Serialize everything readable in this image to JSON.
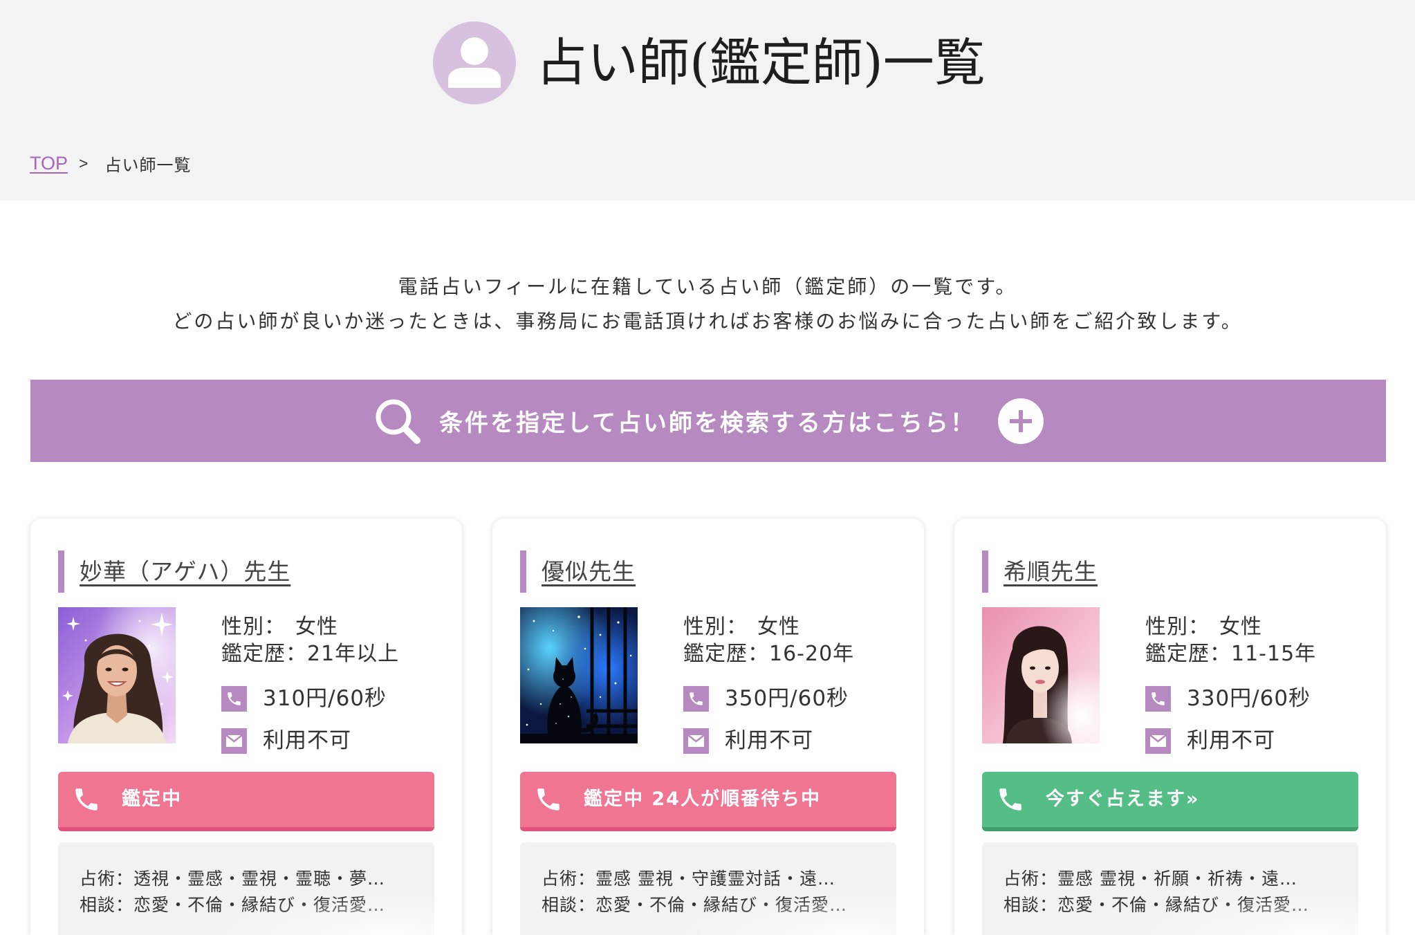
{
  "colors": {
    "accent": "#b68ac0",
    "avatar": "#d8c1df",
    "link": "#a865bb",
    "header": "#f3f3f3",
    "panel": "#f2f2f2"
  },
  "header": {
    "title": "占い師(鑑定師)一覧",
    "avatar_icon": "user-icon"
  },
  "breadcrumb": {
    "home": "TOP",
    "separator": ">",
    "current": "占い師一覧"
  },
  "intro": {
    "line1": "電話占いフィールに在籍している占い師（鑑定師）の一覧です。",
    "line2": "どの占い師が良いか迷ったときは、事務局にお電話頂ければお客様のお悩みに合った占い師をご紹介致します。"
  },
  "search_bar": {
    "label": "条件を指定して占い師を検索する方はこちら！",
    "icon": "search-icon",
    "expand_icon": "plus-circle-icon"
  },
  "labels": {
    "gender": "性別：",
    "experience": "鑑定歴："
  },
  "fortune_tellers": [
    {
      "name": "妙華（アゲハ）先生",
      "gender": "女性",
      "experience": "21年以上",
      "phone_rate": "310円/60秒",
      "mail_status": "利用不可",
      "status_label": "鑑定中",
      "button_color": "#f07592",
      "button_shadow_color": "#e3527b",
      "techniques": "占術：透視・霊感・霊視・霊聴・夢…",
      "consultation": "相談：恋愛・不倫・縁結び・復活愛…"
    },
    {
      "name": "優似先生",
      "gender": "女性",
      "experience": "16-20年",
      "phone_rate": "350円/60秒",
      "mail_status": "利用不可",
      "status_label": "鑑定中 24人が順番待ち中",
      "button_color": "#f07592",
      "button_shadow_color": "#e3527b",
      "techniques": "占術：霊感 霊視・守護霊対話・遠…",
      "consultation": "相談：恋愛・不倫・縁結び・復活愛…"
    },
    {
      "name": "希順先生",
      "gender": "女性",
      "experience": "11-15年",
      "phone_rate": "330円/60秒",
      "mail_status": "利用不可",
      "status_label": "今すぐ占えます»",
      "button_color": "#55bd86",
      "button_shadow_color": "#3f9f6c",
      "techniques": "占術：霊感 霊視・祈願・祈祷・遠…",
      "consultation": "相談：恋愛・不倫・縁結び・復活愛…"
    }
  ]
}
